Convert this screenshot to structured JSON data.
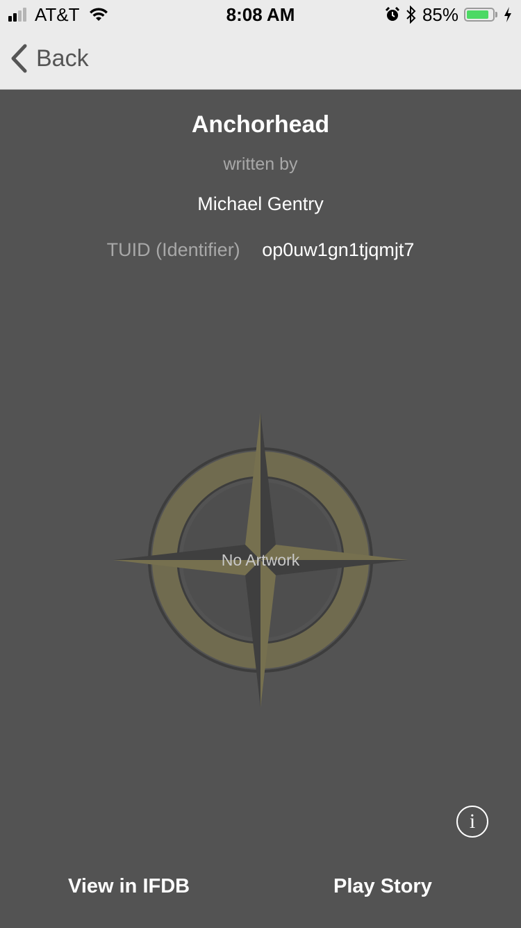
{
  "status_bar": {
    "carrier": "AT&T",
    "time": "8:08 AM",
    "battery_percent_text": "85%",
    "battery_level": 0.85,
    "signal_bars_filled": 2,
    "signal_bars_total": 4
  },
  "nav": {
    "back_label": "Back"
  },
  "story": {
    "title": "Anchorhead",
    "written_by_label": "written by",
    "author": "Michael Gentry",
    "tuid_label": "TUID (Identifier)",
    "tuid_value": "op0uw1gn1tjqmjt7",
    "no_artwork_label": "No Artwork"
  },
  "actions": {
    "info_icon": "info-icon",
    "view_ifdb_label": "View in IFDB",
    "play_story_label": "Play Story"
  },
  "colors": {
    "background": "#535353",
    "header": "#ebebeb",
    "battery_green": "#4cd964",
    "compass_gold": "#76704f"
  }
}
